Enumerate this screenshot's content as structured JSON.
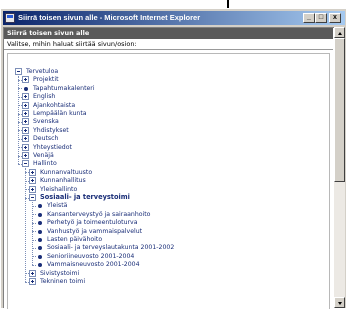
{
  "window": {
    "title": "Siirrä toisen sivun alle - Microsoft Internet Explorer",
    "minimize": "_",
    "maximize": "□",
    "close": "x"
  },
  "dialog": {
    "header": "Siirrä toisen sivun alle",
    "instruction": "Valitse, mihin haluat siirtää sivun/osion:"
  },
  "tree": [
    {
      "label": "Tervetuloa",
      "icon": "minus"
    },
    {
      "label": "Projektit",
      "icon": "plus"
    },
    {
      "label": "Tapahtumakalenteri",
      "icon": "dot"
    },
    {
      "label": "English",
      "icon": "plus"
    },
    {
      "label": "Ajankohtaista",
      "icon": "plus"
    },
    {
      "label": "Lempäälän kunta",
      "icon": "plus"
    },
    {
      "label": "Svenska",
      "icon": "plus"
    },
    {
      "label": "Yhdistykset",
      "icon": "plus"
    },
    {
      "label": "Deutsch",
      "icon": "plus"
    },
    {
      "label": "Yhteystiedot",
      "icon": "plus"
    },
    {
      "label": "Venäjä",
      "icon": "plus"
    },
    {
      "label": "Hallinto",
      "icon": "minus"
    },
    {
      "label": "Kunnanvaltuusto",
      "icon": "plus"
    },
    {
      "label": "Kunnanhallitus",
      "icon": "plus"
    },
    {
      "label": "Yleishallinto",
      "icon": "plus"
    },
    {
      "label": "Sosiaali- ja terveystoimi",
      "icon": "minus",
      "bold": true
    },
    {
      "label": "Yleistä",
      "icon": "dot"
    },
    {
      "label": "Kansanterveystyö ja sairaanhoito",
      "icon": "dot"
    },
    {
      "label": "Perhetyö ja toimeentuloturva",
      "icon": "dot"
    },
    {
      "label": "Vanhustyö ja vammaispalvelut",
      "icon": "dot"
    },
    {
      "label": "Lasten päivähoito",
      "icon": "dot"
    },
    {
      "label": "Sosiaali- ja terveyslautakunta 2001-2002",
      "icon": "dot"
    },
    {
      "label": "Senioriineuvosto 2001-2004",
      "icon": "dot"
    },
    {
      "label": "Vammaisneuvosto 2001-2004",
      "icon": "dot"
    },
    {
      "label": "Sivistystoimi",
      "icon": "plus"
    },
    {
      "label": "Tekninen toimi",
      "icon": "plus"
    }
  ],
  "colors": {
    "title_gradient_start": "#0a246a",
    "header_bg": "#5a5a5a",
    "tree_text": "#1a2e78"
  }
}
